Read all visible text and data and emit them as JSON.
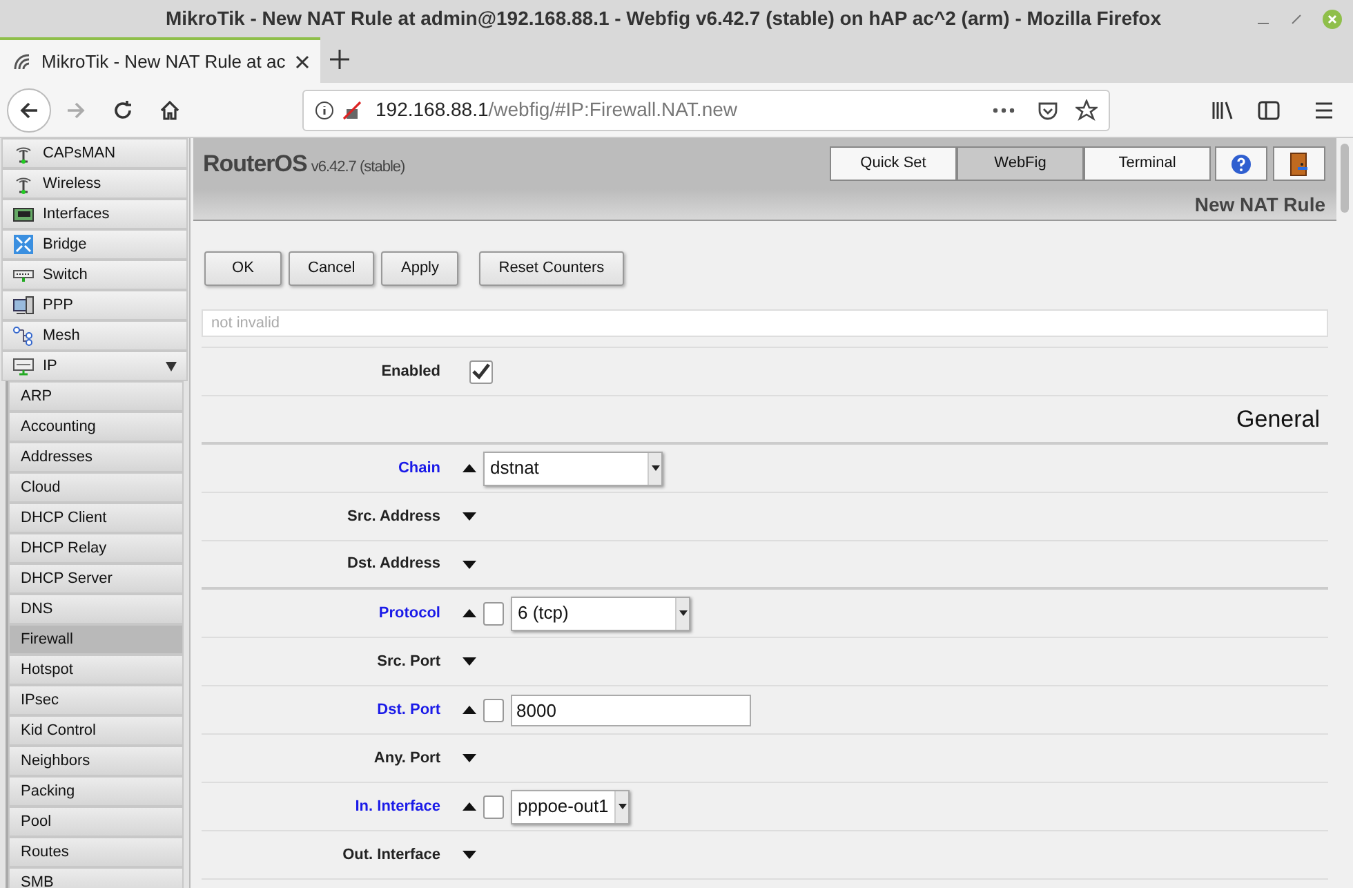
{
  "browser": {
    "window_title": "MikroTik - New NAT Rule at admin@192.168.88.1 - Webfig v6.42.7 (stable) on hAP ac^2 (arm) - Mozilla Firefox",
    "tab_title": "MikroTik - New NAT Rule at ac",
    "url_host": "192.168.88.1",
    "url_path": "/webfig/#IP:Firewall.NAT.new"
  },
  "sidebar": {
    "items": [
      {
        "label": "CAPsMAN"
      },
      {
        "label": "Wireless"
      },
      {
        "label": "Interfaces"
      },
      {
        "label": "Bridge"
      },
      {
        "label": "Switch"
      },
      {
        "label": "PPP"
      },
      {
        "label": "Mesh"
      },
      {
        "label": "IP",
        "expanded": true,
        "children": [
          {
            "label": "ARP",
            "selected": false
          },
          {
            "label": "Accounting",
            "selected": false
          },
          {
            "label": "Addresses",
            "selected": false
          },
          {
            "label": "Cloud",
            "selected": false
          },
          {
            "label": "DHCP Client",
            "selected": false
          },
          {
            "label": "DHCP Relay",
            "selected": false
          },
          {
            "label": "DHCP Server",
            "selected": false
          },
          {
            "label": "DNS",
            "selected": false
          },
          {
            "label": "Firewall",
            "selected": true
          },
          {
            "label": "Hotspot",
            "selected": false
          },
          {
            "label": "IPsec",
            "selected": false
          },
          {
            "label": "Kid Control",
            "selected": false
          },
          {
            "label": "Neighbors",
            "selected": false
          },
          {
            "label": "Packing",
            "selected": false
          },
          {
            "label": "Pool",
            "selected": false
          },
          {
            "label": "Routes",
            "selected": false
          },
          {
            "label": "SMB",
            "selected": false
          }
        ]
      }
    ]
  },
  "header": {
    "brand": "RouterOS",
    "version": "v6.42.7 (stable)",
    "mode_buttons": [
      {
        "label": "Quick Set",
        "selected": false
      },
      {
        "label": "WebFig",
        "selected": true
      },
      {
        "label": "Terminal",
        "selected": false
      }
    ],
    "page_title": "New NAT Rule"
  },
  "action_buttons": [
    "OK",
    "Cancel",
    "Apply",
    "Reset Counters"
  ],
  "status_field": {
    "text": "not invalid"
  },
  "form": {
    "rows": [
      {
        "kind": "checkbox",
        "label": "Enabled",
        "set": false,
        "checked": true
      },
      {
        "kind": "section",
        "label": "General"
      },
      {
        "kind": "select",
        "label": "Chain",
        "set": true,
        "value": "dstnat"
      },
      {
        "kind": "collapsed",
        "label": "Src. Address",
        "set": false
      },
      {
        "kind": "collapsed",
        "label": "Dst. Address",
        "set": false,
        "divider_after": true
      },
      {
        "kind": "select",
        "label": "Protocol",
        "set": true,
        "negated": false,
        "value": "6 (tcp)"
      },
      {
        "kind": "collapsed",
        "label": "Src. Port",
        "set": false
      },
      {
        "kind": "text",
        "label": "Dst. Port",
        "set": true,
        "negated": false,
        "value": "8000"
      },
      {
        "kind": "collapsed",
        "label": "Any. Port",
        "set": false
      },
      {
        "kind": "select",
        "label": "In. Interface",
        "set": true,
        "negated": false,
        "value": "pppoe-out1",
        "short": true
      },
      {
        "kind": "collapsed",
        "label": "Out. Interface",
        "set": false
      }
    ]
  }
}
